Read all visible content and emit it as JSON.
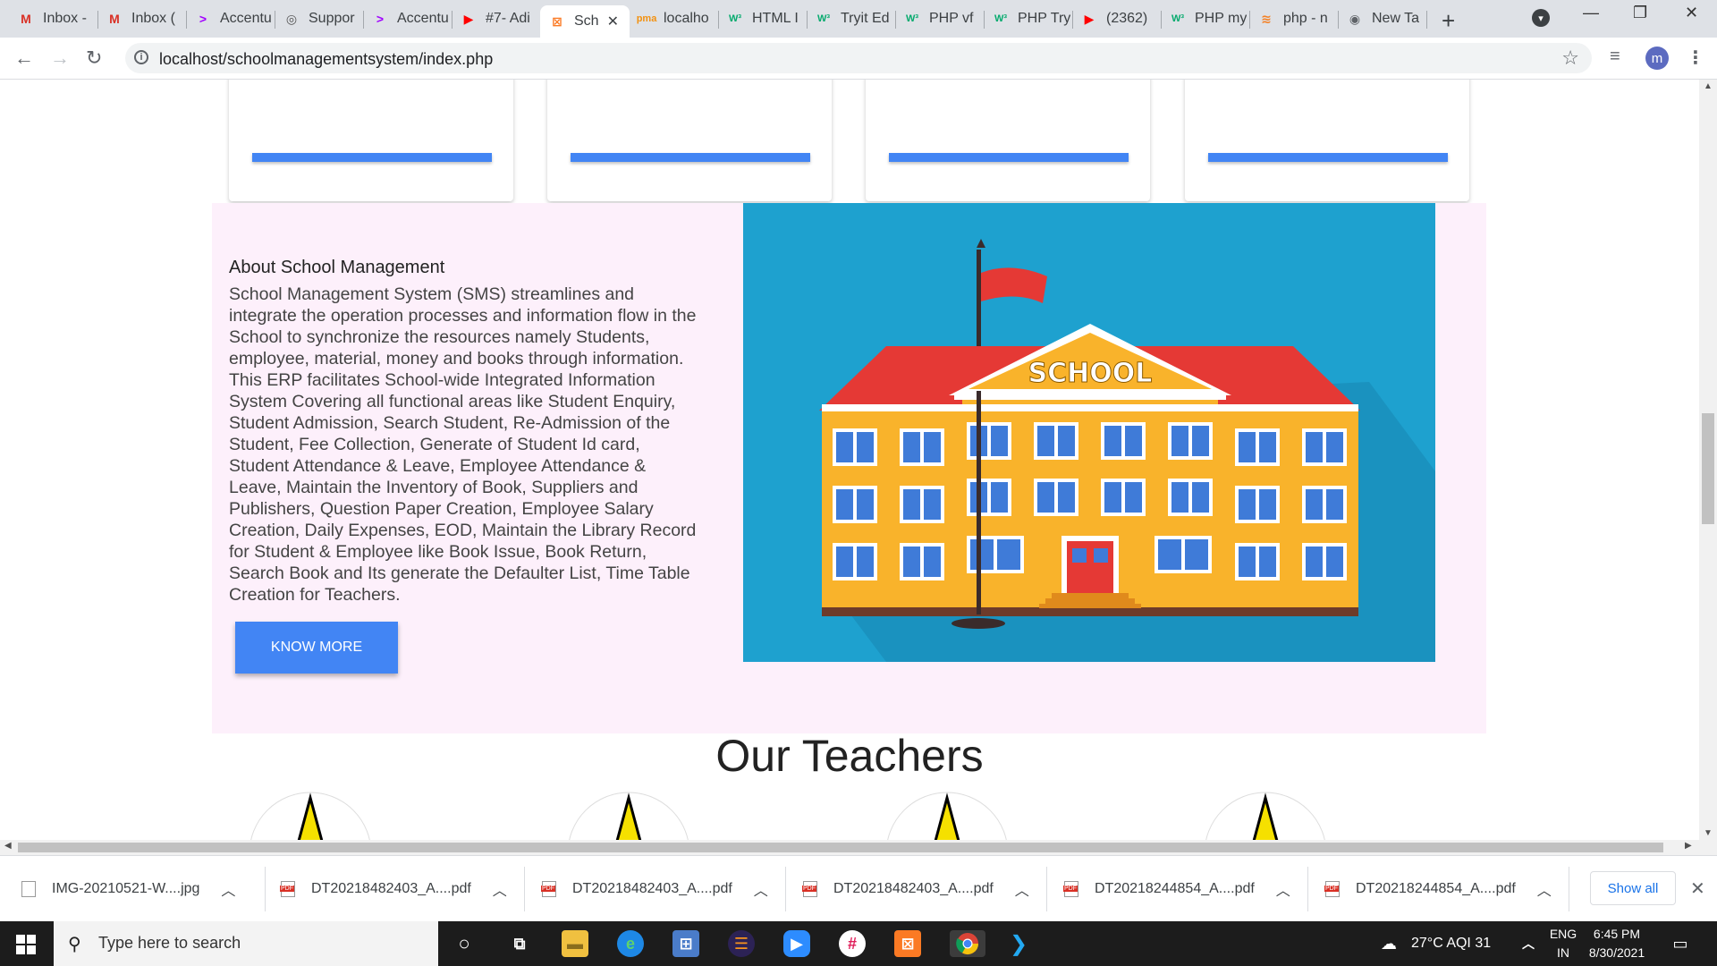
{
  "browser": {
    "tabs": [
      {
        "label": "Inbox -",
        "icon": "M",
        "color": "#d93025"
      },
      {
        "label": "Inbox (",
        "icon": "M",
        "color": "#d93025"
      },
      {
        "label": "Accentu",
        "icon": ">",
        "color": "#a100ff"
      },
      {
        "label": "Suppor",
        "icon": "◎",
        "color": "#555555"
      },
      {
        "label": "Accentu",
        "icon": ">",
        "color": "#a100ff"
      },
      {
        "label": "#7- Adi",
        "icon": "▶",
        "color": "#ff0000"
      },
      {
        "label": "Sch",
        "icon": "⊠",
        "color": "#fb7a24",
        "active": true
      },
      {
        "label": "localho",
        "icon": "pma",
        "color": "#f29111"
      },
      {
        "label": "HTML I",
        "icon": "W³",
        "color": "#04aa6d"
      },
      {
        "label": "Tryit Ed",
        "icon": "W³",
        "color": "#04aa6d"
      },
      {
        "label": "PHP vf",
        "icon": "W³",
        "color": "#04aa6d"
      },
      {
        "label": "PHP Try",
        "icon": "W³",
        "color": "#04aa6d"
      },
      {
        "label": "(2362)",
        "icon": "▶",
        "color": "#ff0000"
      },
      {
        "label": "PHP my",
        "icon": "W³",
        "color": "#04aa6d"
      },
      {
        "label": "php - n",
        "icon": "≋",
        "color": "#f48024"
      },
      {
        "label": "New Ta",
        "icon": "◉",
        "color": "#5f6368"
      }
    ],
    "new_tab_label": "+",
    "url": "localhost/schoolmanagementsystem/index.php",
    "profile_initial": "m"
  },
  "page": {
    "about_title": "About School Management",
    "about_text": "School Management System (SMS) streamlines and integrate the operation processes and information flow in the School to synchronize the resources namely Students, employee, material, money and books through information. This ERP facilitates School-wide Integrated Information System Covering all functional areas like Student Enquiry, Student Admission, Search Student, Re-Admission of the Student, Fee Collection, Generate of Student Id card, Student Attendance & Leave, Employee Attendance & Leave, Maintain the Inventory of Book, Suppliers and Publishers, Question Paper Creation, Employee Salary Creation, Daily Expenses, EOD, Maintain the Library Record for Student & Employee like Book Issue, Book Return, Search Book and Its generate the Defaulter List, Time Table Creation for Teachers.",
    "know_more_label": "KNOW MORE",
    "school_sign": "SCHOOL",
    "teachers_title": "Our Teachers",
    "colors": {
      "accent": "#4285f4",
      "about_bg": "#fdf0fb",
      "image_bg": "#1ea1cf"
    }
  },
  "downloads": {
    "items": [
      {
        "name": "IMG-20210521-W....jpg",
        "type": "image"
      },
      {
        "name": "DT20218482403_A....pdf",
        "type": "pdf"
      },
      {
        "name": "DT20218482403_A....pdf",
        "type": "pdf"
      },
      {
        "name": "DT20218482403_A....pdf",
        "type": "pdf"
      },
      {
        "name": "DT20218244854_A....pdf",
        "type": "pdf"
      },
      {
        "name": "DT20218244854_A....pdf",
        "type": "pdf"
      }
    ],
    "show_all_label": "Show all"
  },
  "taskbar": {
    "search_placeholder": "Type here to search",
    "weather": "27°C  AQI 31",
    "lang_line1": "ENG",
    "lang_line2": "IN",
    "time": "6:45 PM",
    "date": "8/30/2021"
  }
}
